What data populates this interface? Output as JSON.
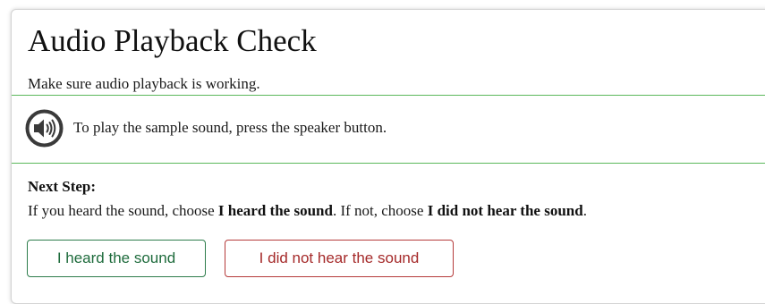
{
  "header": {
    "title": "Audio Playback Check",
    "subtitle": "Make sure audio playback is working."
  },
  "sample": {
    "icon": "speaker-icon",
    "instruction": "To play the sample sound, press the speaker button."
  },
  "next_step": {
    "heading": "Next Step:",
    "text_1": "If you heard the sound, choose ",
    "bold_1": "I heard the sound",
    "text_2": ". If not, choose ",
    "bold_2": "I did not hear the sound",
    "text_3": "."
  },
  "buttons": {
    "heard_label": "I heard the sound",
    "not_heard_label": "I did not hear the sound"
  },
  "colors": {
    "divider": "#5cb85c",
    "heard": "#1e6b3c",
    "not_heard": "#a52a2a"
  }
}
